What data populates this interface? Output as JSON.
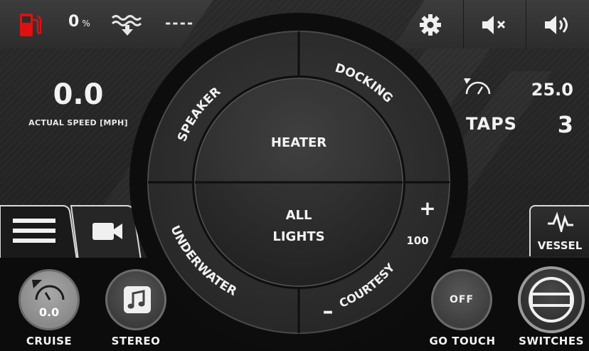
{
  "status_bar": {
    "fuel_percent": "0",
    "fuel_unit": "%",
    "depth_value": "----",
    "fuel_icon_color": "#e01010"
  },
  "speed": {
    "value": "0.0",
    "label": "ACTUAL SPEED [MPH]"
  },
  "wake": {
    "limit_value": "25.0",
    "taps_label": "TAPS",
    "taps_value": "3"
  },
  "lighting_dial": {
    "top_left_label": "SPEAKER",
    "top_right_label": "DOCKING",
    "bottom_left_label": "UNDERWATER",
    "bottom_right_label": "COURTESY",
    "inner_top_label": "HEATER",
    "inner_bottom_label_line1": "ALL",
    "inner_bottom_label_line2": "LIGHTS",
    "level_value": "100",
    "plus_label": "+",
    "minus_label": "–"
  },
  "tabs": {
    "vessel_label": "VESSEL"
  },
  "bottom_nav": {
    "cruise_label": "CRUISE",
    "cruise_value": "0.0",
    "stereo_label": "STEREO",
    "go_touch_label": "GO TOUCH",
    "go_touch_state": "OFF",
    "switches_label": "SWITCHES"
  },
  "icons": {
    "fuel": "fuel-pump-icon",
    "depth": "depth-icon",
    "settings": "gear-icon",
    "mute": "speaker-mute-icon",
    "volume": "speaker-volume-icon",
    "wake_speed": "speedometer-icon",
    "menu": "hamburger-menu-icon",
    "camera": "video-camera-icon",
    "vessel": "waveform-icon",
    "stereo": "music-note-icon",
    "switches": "switch-circle-icon"
  }
}
